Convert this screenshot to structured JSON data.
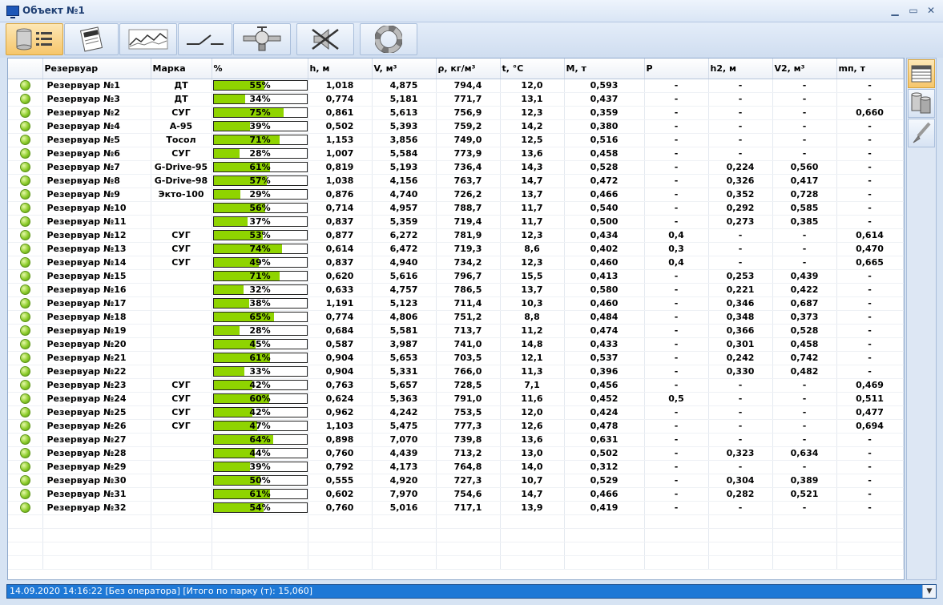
{
  "window": {
    "title": "Объект №1"
  },
  "table": {
    "columns": [
      "Резервуар",
      "Марка",
      "%",
      "h, м",
      "V, м³",
      "ρ, кг/м³",
      "t, °C",
      "M, т",
      "P",
      "h2, м",
      "V2, м³",
      "mп, т"
    ],
    "rows": [
      {
        "name": "Резервуар №1",
        "brand": "ДТ",
        "pct": 55,
        "pct_label": "55%",
        "h": "1,018",
        "v": "4,875",
        "rho": "794,4",
        "t": "12,0",
        "m": "0,593",
        "p": "-",
        "h2": "-",
        "v2": "-",
        "mp": "-"
      },
      {
        "name": "Резервуар №3",
        "brand": "ДТ",
        "pct": 34,
        "pct_label": "34%",
        "h": "0,774",
        "v": "5,181",
        "rho": "771,7",
        "t": "13,1",
        "m": "0,437",
        "p": "-",
        "h2": "-",
        "v2": "-",
        "mp": "-"
      },
      {
        "name": "Резервуар №2",
        "brand": "СУГ",
        "pct": 75,
        "pct_label": "75%",
        "h": "0,861",
        "v": "5,613",
        "rho": "756,9",
        "t": "12,3",
        "m": "0,359",
        "p": "-",
        "h2": "-",
        "v2": "-",
        "mp": "0,660"
      },
      {
        "name": "Резервуар №4",
        "brand": "А-95",
        "pct": 39,
        "pct_label": "39%",
        "h": "0,502",
        "v": "5,393",
        "rho": "759,2",
        "t": "14,2",
        "m": "0,380",
        "p": "-",
        "h2": "-",
        "v2": "-",
        "mp": "-"
      },
      {
        "name": "Резервуар №5",
        "brand": "Тосол",
        "pct": 71,
        "pct_label": "71%",
        "h": "1,153",
        "v": "3,856",
        "rho": "749,0",
        "t": "12,5",
        "m": "0,516",
        "p": "-",
        "h2": "-",
        "v2": "-",
        "mp": "-"
      },
      {
        "name": "Резервуар №6",
        "brand": "СУГ",
        "pct": 28,
        "pct_label": "28%",
        "h": "1,007",
        "v": "5,584",
        "rho": "773,9",
        "t": "13,6",
        "m": "0,458",
        "p": "-",
        "h2": "-",
        "v2": "-",
        "mp": "-"
      },
      {
        "name": "Резервуар №7",
        "brand": "G-Drive-95",
        "pct": 61,
        "pct_label": "61%",
        "h": "0,819",
        "v": "5,193",
        "rho": "736,4",
        "t": "14,3",
        "m": "0,528",
        "p": "-",
        "h2": "0,224",
        "v2": "0,560",
        "mp": "-"
      },
      {
        "name": "Резервуар №8",
        "brand": "G-Drive-98",
        "pct": 57,
        "pct_label": "57%",
        "h": "1,038",
        "v": "4,156",
        "rho": "763,7",
        "t": "14,7",
        "m": "0,472",
        "p": "-",
        "h2": "0,326",
        "v2": "0,417",
        "mp": "-"
      },
      {
        "name": "Резервуар №9",
        "brand": "Экто-100",
        "pct": 29,
        "pct_label": "29%",
        "h": "0,876",
        "v": "4,740",
        "rho": "726,2",
        "t": "13,7",
        "m": "0,466",
        "p": "-",
        "h2": "0,352",
        "v2": "0,728",
        "mp": "-"
      },
      {
        "name": "Резервуар №10",
        "brand": "",
        "pct": 56,
        "pct_label": "56%",
        "h": "0,714",
        "v": "4,957",
        "rho": "788,7",
        "t": "11,7",
        "m": "0,540",
        "p": "-",
        "h2": "0,292",
        "v2": "0,585",
        "mp": "-"
      },
      {
        "name": "Резервуар №11",
        "brand": "",
        "pct": 37,
        "pct_label": "37%",
        "h": "0,837",
        "v": "5,359",
        "rho": "719,4",
        "t": "11,7",
        "m": "0,500",
        "p": "-",
        "h2": "0,273",
        "v2": "0,385",
        "mp": "-"
      },
      {
        "name": "Резервуар №12",
        "brand": "СУГ",
        "pct": 53,
        "pct_label": "53%",
        "h": "0,877",
        "v": "6,272",
        "rho": "781,9",
        "t": "12,3",
        "m": "0,434",
        "p": "0,4",
        "h2": "-",
        "v2": "-",
        "mp": "0,614"
      },
      {
        "name": "Резервуар №13",
        "brand": "СУГ",
        "pct": 74,
        "pct_label": "74%",
        "h": "0,614",
        "v": "6,472",
        "rho": "719,3",
        "t": "8,6",
        "m": "0,402",
        "p": "0,3",
        "h2": "-",
        "v2": "-",
        "mp": "0,470"
      },
      {
        "name": "Резервуар №14",
        "brand": "СУГ",
        "pct": 49,
        "pct_label": "49%",
        "h": "0,837",
        "v": "4,940",
        "rho": "734,2",
        "t": "12,3",
        "m": "0,460",
        "p": "0,4",
        "h2": "-",
        "v2": "-",
        "mp": "0,665"
      },
      {
        "name": "Резервуар №15",
        "brand": "",
        "pct": 71,
        "pct_label": "71%",
        "h": "0,620",
        "v": "5,616",
        "rho": "796,7",
        "t": "15,5",
        "m": "0,413",
        "p": "-",
        "h2": "0,253",
        "v2": "0,439",
        "mp": "-"
      },
      {
        "name": "Резервуар №16",
        "brand": "",
        "pct": 32,
        "pct_label": "32%",
        "h": "0,633",
        "v": "4,757",
        "rho": "786,5",
        "t": "13,7",
        "m": "0,580",
        "p": "-",
        "h2": "0,221",
        "v2": "0,422",
        "mp": "-"
      },
      {
        "name": "Резервуар №17",
        "brand": "",
        "pct": 38,
        "pct_label": "38%",
        "h": "1,191",
        "v": "5,123",
        "rho": "711,4",
        "t": "10,3",
        "m": "0,460",
        "p": "-",
        "h2": "0,346",
        "v2": "0,687",
        "mp": "-"
      },
      {
        "name": "Резервуар №18",
        "brand": "",
        "pct": 65,
        "pct_label": "65%",
        "h": "0,774",
        "v": "4,806",
        "rho": "751,2",
        "t": "8,8",
        "m": "0,484",
        "p": "-",
        "h2": "0,348",
        "v2": "0,373",
        "mp": "-"
      },
      {
        "name": "Резервуар №19",
        "brand": "",
        "pct": 28,
        "pct_label": "28%",
        "h": "0,684",
        "v": "5,581",
        "rho": "713,7",
        "t": "11,2",
        "m": "0,474",
        "p": "-",
        "h2": "0,366",
        "v2": "0,528",
        "mp": "-"
      },
      {
        "name": "Резервуар №20",
        "brand": "",
        "pct": 45,
        "pct_label": "45%",
        "h": "0,587",
        "v": "3,987",
        "rho": "741,0",
        "t": "14,8",
        "m": "0,433",
        "p": "-",
        "h2": "0,301",
        "v2": "0,458",
        "mp": "-"
      },
      {
        "name": "Резервуар №21",
        "brand": "",
        "pct": 61,
        "pct_label": "61%",
        "h": "0,904",
        "v": "5,653",
        "rho": "703,5",
        "t": "12,1",
        "m": "0,537",
        "p": "-",
        "h2": "0,242",
        "v2": "0,742",
        "mp": "-"
      },
      {
        "name": "Резервуар №22",
        "brand": "",
        "pct": 33,
        "pct_label": "33%",
        "h": "0,904",
        "v": "5,331",
        "rho": "766,0",
        "t": "11,3",
        "m": "0,396",
        "p": "-",
        "h2": "0,330",
        "v2": "0,482",
        "mp": "-"
      },
      {
        "name": "Резервуар №23",
        "brand": "СУГ",
        "pct": 42,
        "pct_label": "42%",
        "h": "0,763",
        "v": "5,657",
        "rho": "728,5",
        "t": "7,1",
        "m": "0,456",
        "p": "-",
        "h2": "-",
        "v2": "-",
        "mp": "0,469"
      },
      {
        "name": "Резервуар №24",
        "brand": "СУГ",
        "pct": 60,
        "pct_label": "60%",
        "h": "0,624",
        "v": "5,363",
        "rho": "791,0",
        "t": "11,6",
        "m": "0,452",
        "p": "0,5",
        "h2": "-",
        "v2": "-",
        "mp": "0,511"
      },
      {
        "name": "Резервуар №25",
        "brand": "СУГ",
        "pct": 42,
        "pct_label": "42%",
        "h": "0,962",
        "v": "4,242",
        "rho": "753,5",
        "t": "12,0",
        "m": "0,424",
        "p": "-",
        "h2": "-",
        "v2": "-",
        "mp": "0,477"
      },
      {
        "name": "Резервуар №26",
        "brand": "СУГ",
        "pct": 47,
        "pct_label": "47%",
        "h": "1,103",
        "v": "5,475",
        "rho": "777,3",
        "t": "12,6",
        "m": "0,478",
        "p": "-",
        "h2": "-",
        "v2": "-",
        "mp": "0,694"
      },
      {
        "name": "Резервуар №27",
        "brand": "",
        "pct": 64,
        "pct_label": "64%",
        "h": "0,898",
        "v": "7,070",
        "rho": "739,8",
        "t": "13,6",
        "m": "0,631",
        "p": "-",
        "h2": "-",
        "v2": "-",
        "mp": "-"
      },
      {
        "name": "Резервуар №28",
        "brand": "",
        "pct": 44,
        "pct_label": "44%",
        "h": "0,760",
        "v": "4,439",
        "rho": "713,2",
        "t": "13,0",
        "m": "0,502",
        "p": "-",
        "h2": "0,323",
        "v2": "0,634",
        "mp": "-"
      },
      {
        "name": "Резервуар №29",
        "brand": "",
        "pct": 39,
        "pct_label": "39%",
        "h": "0,792",
        "v": "4,173",
        "rho": "764,8",
        "t": "14,0",
        "m": "0,312",
        "p": "-",
        "h2": "-",
        "v2": "-",
        "mp": "-"
      },
      {
        "name": "Резервуар №30",
        "brand": "",
        "pct": 50,
        "pct_label": "50%",
        "h": "0,555",
        "v": "4,920",
        "rho": "727,3",
        "t": "10,7",
        "m": "0,529",
        "p": "-",
        "h2": "0,304",
        "v2": "0,389",
        "mp": "-"
      },
      {
        "name": "Резервуар №31",
        "brand": "",
        "pct": 61,
        "pct_label": "61%",
        "h": "0,602",
        "v": "7,970",
        "rho": "754,6",
        "t": "14,7",
        "m": "0,466",
        "p": "-",
        "h2": "0,282",
        "v2": "0,521",
        "mp": "-"
      },
      {
        "name": "Резервуар №32",
        "brand": "",
        "pct": 54,
        "pct_label": "54%",
        "h": "0,760",
        "v": "5,016",
        "rho": "717,1",
        "t": "13,9",
        "m": "0,419",
        "p": "-",
        "h2": "-",
        "v2": "-",
        "mp": "-"
      }
    ]
  },
  "statusbar": {
    "text": "14.09.2020 14:16:22 [Без оператора] [Итого по парку  (т): 15,060]"
  },
  "toolbar": {
    "buttons": [
      "tanks-list-icon",
      "report-icon",
      "trend-chart-icon",
      "switch-icon",
      "valve-icon",
      "mute-sound-icon",
      "lifebuoy-help-icon"
    ]
  },
  "sidepanel": {
    "buttons": [
      "table-view-icon",
      "tanks-view-icon",
      "brush-icon"
    ]
  },
  "colors": {
    "bar_fill": "#8fd400",
    "status_bg": "#1e78d6",
    "active_button": "#f6c66b"
  }
}
